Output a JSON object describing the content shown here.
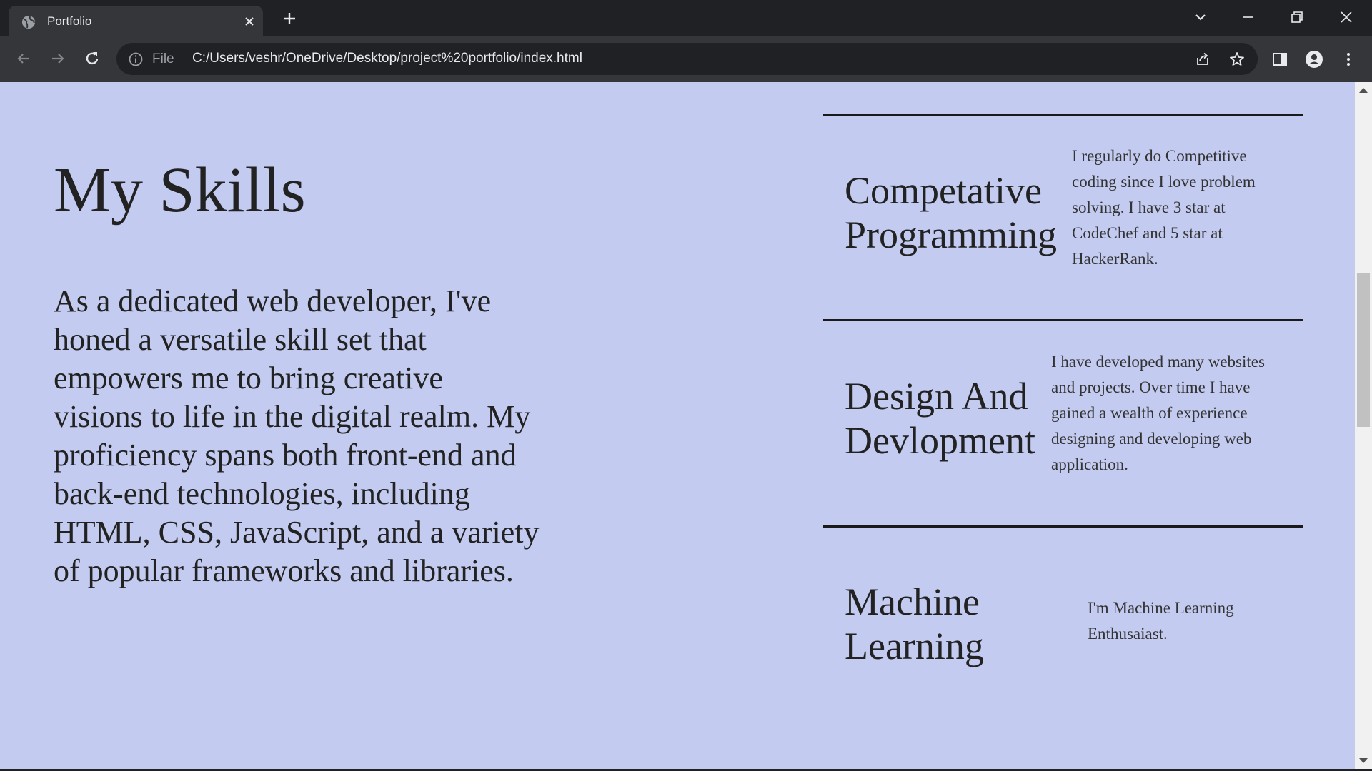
{
  "browser": {
    "tab_title": "Portfolio",
    "scheme_label": "File",
    "url": "C:/Users/veshr/OneDrive/Desktop/project%20portfolio/index.html"
  },
  "page": {
    "title": "My Skills",
    "intro": "As a dedicated web developer, I've honed a versatile skill set that empowers me to bring creative visions to life in the digital realm. My proficiency spans both front-end and back-end technologies, including HTML, CSS, JavaScript, and a variety of popular frameworks and libraries.",
    "skills": [
      {
        "name": "Competative Programming",
        "description": "I regularly do Competitive coding since I love problem solving. I have 3 star at CodeChef and 5 star at HackerRank."
      },
      {
        "name": "Design And Devlopment",
        "description": "I have developed many websites and projects. Over time I have gained a wealth of experience designing and developing web application."
      },
      {
        "name": "Machine Learning",
        "description": "I'm Machine Learning Enthusaiast."
      }
    ]
  },
  "colors": {
    "page_background": "#c3cbf0",
    "browser_frame": "#202124",
    "toolbar": "#35363a"
  }
}
